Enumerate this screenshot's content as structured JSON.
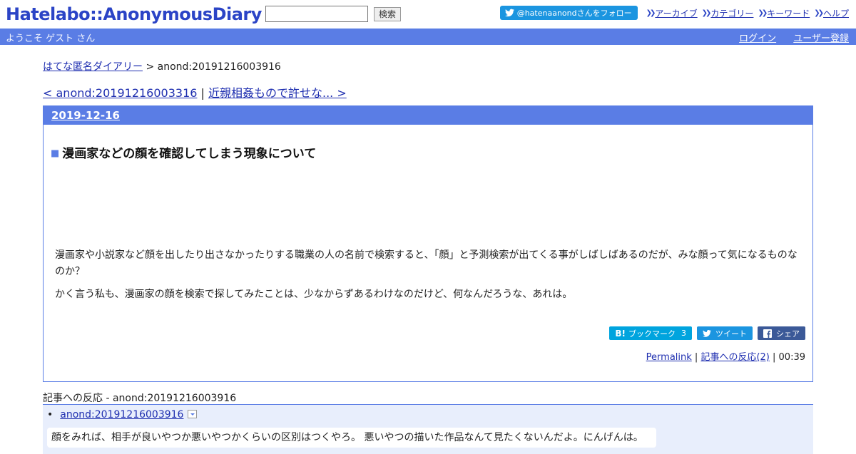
{
  "header": {
    "logo": "Hatelabo::AnonymousDiary",
    "search_value": "",
    "search_button": "検索",
    "follow_button": "@hatenaanondさんをフォロー",
    "nav": [
      "アーカイブ",
      "カテゴリー",
      "キーワード",
      "ヘルプ"
    ]
  },
  "welcome": {
    "text": "ようこそ ゲスト さん",
    "login": "ログイン",
    "register": "ユーザー登録"
  },
  "breadcrumb": {
    "home": "はてな匿名ダイアリー",
    "separator": " > ",
    "current": "anond:20191216003916"
  },
  "pager": {
    "prev": "< anond:20191216003316",
    "separator": " | ",
    "next": "近親相姦もので許せな... >"
  },
  "day": {
    "date": "2019-12-16"
  },
  "entry": {
    "title_mark": "■",
    "title": "漫画家などの顔を確認してしまう現象について",
    "paragraphs": [
      "漫画家や小説家など顔を出したり出さなかったりする職業の人の名前で検索すると、「顔」と予測検索が出てくる事がしばしばあるのだが、みな顔って気になるものなのか？",
      "かく言う私も、漫画家の顔を検索で探してみたことは、少なからずあるわけなのだけど、何なんだろうな、あれは。"
    ],
    "share": {
      "hatena_label": "ブックマーク",
      "hatena_b": "B!",
      "hatena_count": "3",
      "tweet": "ツイート",
      "facebook": "シェア"
    },
    "footer": {
      "permalink": "Permalink",
      "sep1": " | ",
      "reactions_link": "記事への反応(2)",
      "sep2": " | ",
      "time": "00:39"
    }
  },
  "reactions": {
    "title_label": "記事への反応",
    "title_sep": " - ",
    "title_id": "anond:20191216003916",
    "items": [
      {
        "id": "anond:20191216003916",
        "text": "顔をみれば、相手が良いやつか悪いやつかくらいの区別はつくやろ。 悪いやつの描いた作品なんて見たくないんだよ。にんげんは。"
      }
    ]
  },
  "colors": {
    "accent": "#5a7de5",
    "logo": "#2b44c6",
    "twitter": "#1b95e0",
    "hatena": "#00a4de",
    "facebook": "#3b5998"
  }
}
